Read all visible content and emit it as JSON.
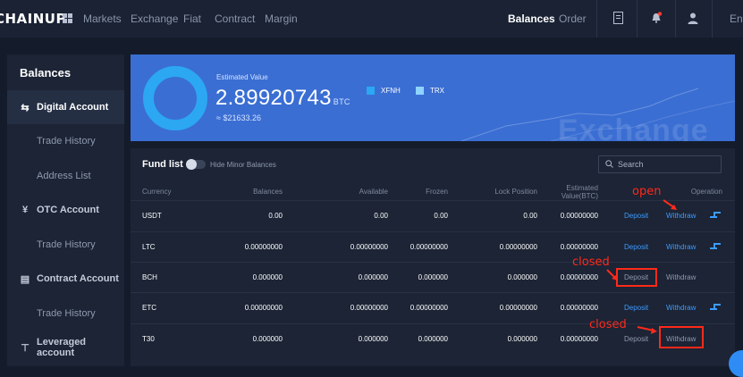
{
  "topbar": {
    "logo": "CHAINUP",
    "nav": [
      "Markets",
      "Exchange",
      "Fiat",
      "Contract",
      "Margin"
    ],
    "right": {
      "balances": "Balances",
      "order": "Order",
      "lang": "Eng"
    },
    "icons": [
      "grid-icon",
      "document-icon",
      "bell-icon",
      "user-icon"
    ]
  },
  "sidebar": {
    "title": "Balances",
    "items": [
      {
        "label": "Digital Account",
        "icon": "transfer-arrows-icon"
      },
      {
        "label": "Trade History"
      },
      {
        "label": "Address List"
      },
      {
        "label": "OTC Account",
        "icon": "yen-icon"
      },
      {
        "label": "Trade History"
      },
      {
        "label": "Contract Account",
        "icon": "contract-doc-icon"
      },
      {
        "label": "Trade History"
      },
      {
        "label": "Leveraged account",
        "icon": "leverage-icon"
      }
    ]
  },
  "hero": {
    "est_label": "Estimated Value",
    "est_value": "2.89920743",
    "est_unit": "BTC",
    "est_usd": "≈ $21633.26",
    "legend": [
      {
        "name": "XFNH",
        "color": "#2ca7f2"
      },
      {
        "name": "TRX",
        "color": "#8fd3ff"
      }
    ],
    "watermark": "Exchange"
  },
  "fund": {
    "title": "Fund list",
    "hide_minor": "Hide Minor Balances",
    "search_placeholder": "Search",
    "headers": {
      "currency": "Currency",
      "balances": "Balances",
      "available": "Available",
      "frozen": "Frozen",
      "lock": "Lock Position",
      "est1": "Estimated",
      "est2": "Value(BTC)",
      "operation": "Operation"
    },
    "rows": [
      {
        "currency": "USDT",
        "balances": "0.00",
        "available": "0.00",
        "frozen": "0.00",
        "lock": "0.00",
        "est": "0.00000000",
        "deposit": "Deposit",
        "withdraw": "Withdraw",
        "deposit_on": true,
        "withdraw_on": true
      },
      {
        "currency": "LTC",
        "balances": "0.00000000",
        "available": "0.00000000",
        "frozen": "0.00000000",
        "lock": "0.00000000",
        "est": "0.00000000",
        "deposit": "Deposit",
        "withdraw": "Withdraw",
        "deposit_on": true,
        "withdraw_on": true
      },
      {
        "currency": "BCH",
        "balances": "0.000000",
        "available": "0.000000",
        "frozen": "0.000000",
        "lock": "0.000000",
        "est": "0.00000000",
        "deposit": "Deposit",
        "withdraw": "Withdraw",
        "deposit_on": false,
        "withdraw_on": false
      },
      {
        "currency": "ETC",
        "balances": "0.00000000",
        "available": "0.00000000",
        "frozen": "0.00000000",
        "lock": "0.00000000",
        "est": "0.00000000",
        "deposit": "Deposit",
        "withdraw": "Withdraw",
        "deposit_on": true,
        "withdraw_on": true
      },
      {
        "currency": "T30",
        "balances": "0.000000",
        "available": "0.000000",
        "frozen": "0.000000",
        "lock": "0.000000",
        "est": "0.00000000",
        "deposit": "Deposit",
        "withdraw": "Withdraw",
        "deposit_on": false,
        "withdraw_on": false
      }
    ]
  },
  "annotations": {
    "open": "open",
    "closed1": "closed",
    "closed2": "closed"
  },
  "colors": {
    "accent": "#3d9bff",
    "annotation": "#ff2a1a",
    "hero": "#3a6ed3"
  }
}
